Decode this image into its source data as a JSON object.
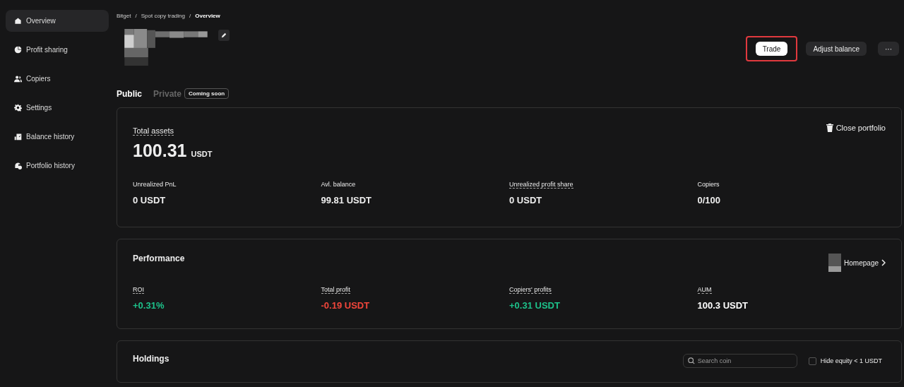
{
  "sidebar": {
    "items": [
      {
        "label": "Overview",
        "selected": true
      },
      {
        "label": "Profit sharing",
        "selected": false
      },
      {
        "label": "Copiers",
        "selected": false
      },
      {
        "label": "Settings",
        "selected": false
      },
      {
        "label": "Balance history",
        "selected": false
      },
      {
        "label": "Portfolio history",
        "selected": false
      }
    ]
  },
  "breadcrumb": [
    {
      "label": "Bitget",
      "separator": "/"
    },
    {
      "label": "Spot copy trading",
      "separator": "/"
    },
    {
      "label": "Overview"
    }
  ],
  "header": {
    "actions": [
      {
        "label": "Trade",
        "kind": "primary",
        "highlighted": true
      },
      {
        "label": "Adjust balance",
        "kind": "secondary",
        "highlighted": false
      },
      {
        "label": "···",
        "kind": "more",
        "highlighted": false
      }
    ]
  },
  "tabs": [
    {
      "label": "Public",
      "selected": true
    },
    {
      "label": "Private",
      "selected": false,
      "badge": "Coming soon"
    }
  ],
  "assets": {
    "title": "Total assets",
    "value": "100.31",
    "unit": "USDT",
    "close": "Close portfolio",
    "stats": [
      {
        "label": "Unrealized PnL",
        "value": "0 USDT",
        "dotted": false
      },
      {
        "label": "Avl. balance",
        "value": "99.81 USDT",
        "dotted": false
      },
      {
        "label": "Unrealized profit share",
        "value": "0 USDT",
        "dotted": true
      },
      {
        "label": "Copiers",
        "value": "0/100",
        "dotted": false
      }
    ]
  },
  "performance": {
    "title": "Performance",
    "link": "Homepage",
    "stats": [
      {
        "label": "ROI",
        "value": "+0.31%",
        "kind": "gain"
      },
      {
        "label": "Total profit",
        "value": "-0.19 USDT",
        "kind": "loss"
      },
      {
        "label": "Copiers' profits",
        "value": "+0.31 USDT",
        "kind": "gain"
      },
      {
        "label": "AUM",
        "value": "100.3 USDT",
        "kind": "plain"
      }
    ]
  },
  "holdings": {
    "title": "Holdings",
    "search": {
      "placeholder": "Search coin"
    },
    "filter": {
      "label": "Hide equity < 1 USDT",
      "checked": false
    }
  }
}
